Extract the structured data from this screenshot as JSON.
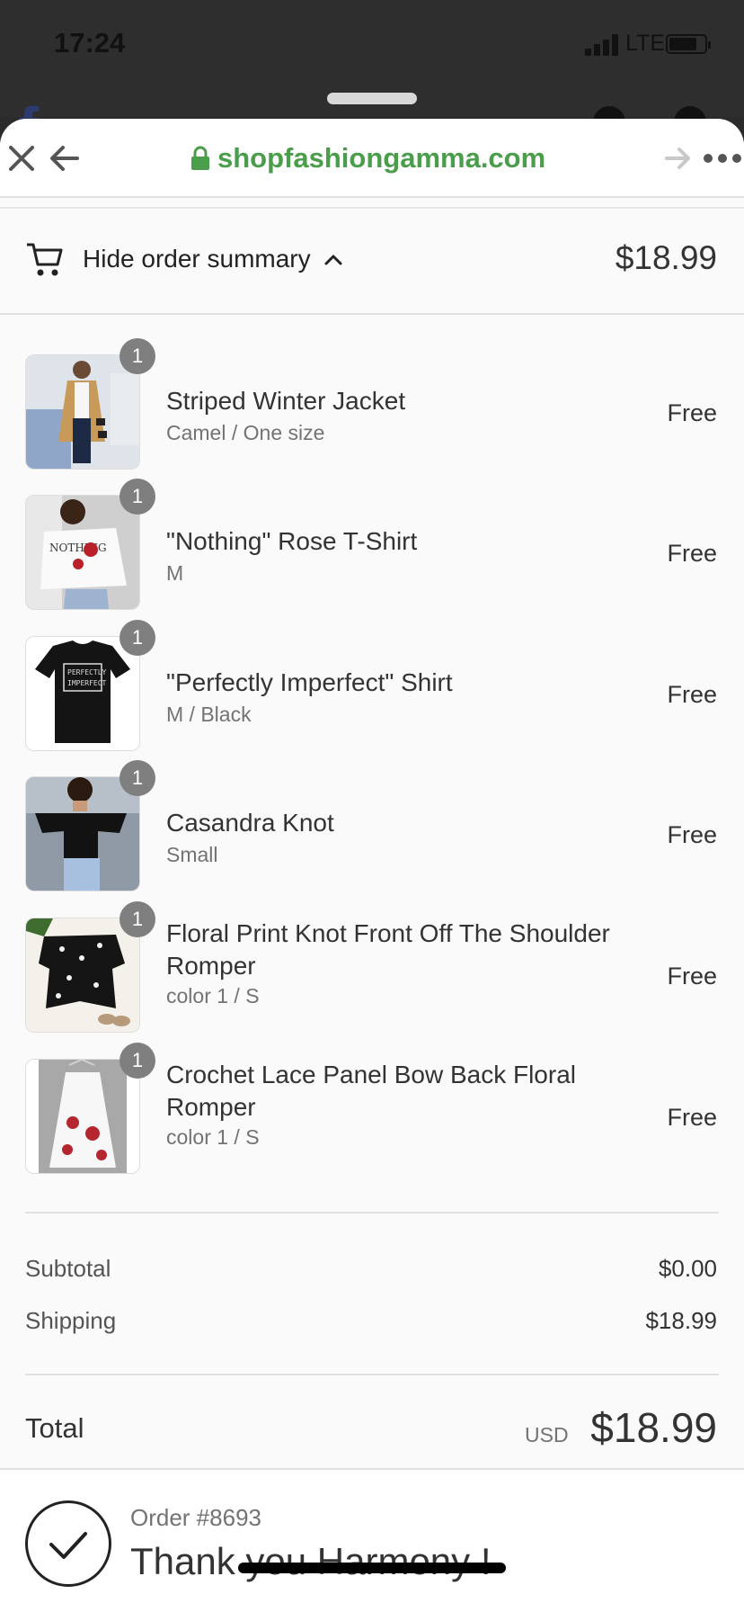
{
  "status_bar": {
    "time": "17:24",
    "network": "LTE"
  },
  "browser": {
    "url": "shopfashiongamma.com"
  },
  "summary": {
    "toggle_label": "Hide order summary",
    "total": "$18.99"
  },
  "items": [
    {
      "title": "Striped Winter Jacket",
      "variant": "Camel / One size",
      "price": "Free",
      "qty": "1"
    },
    {
      "title": "\"Nothing\" Rose T-Shirt",
      "variant": "M",
      "price": "Free",
      "qty": "1"
    },
    {
      "title": "\"Perfectly Imperfect\" Shirt",
      "variant": "M / Black",
      "price": "Free",
      "qty": "1"
    },
    {
      "title": "Casandra Knot",
      "variant": "Small",
      "price": "Free",
      "qty": "1"
    },
    {
      "title": "Floral Print Knot Front Off The Shoulder Romper",
      "variant": "color 1 / S",
      "price": "Free",
      "qty": "1"
    },
    {
      "title": "Crochet Lace Panel Bow Back Floral Romper",
      "variant": "color 1 / S",
      "price": "Free",
      "qty": "1"
    }
  ],
  "totals": {
    "subtotal_label": "Subtotal",
    "subtotal": "$0.00",
    "shipping_label": "Shipping",
    "shipping": "$18.99",
    "total_label": "Total",
    "currency": "USD",
    "total": "$18.99"
  },
  "order": {
    "number": "Order #8693",
    "thanks": "Thank you Harmony !"
  },
  "colors": {
    "accent_green": "#4a9d4a",
    "badge_gray": "#7f7f7f"
  }
}
